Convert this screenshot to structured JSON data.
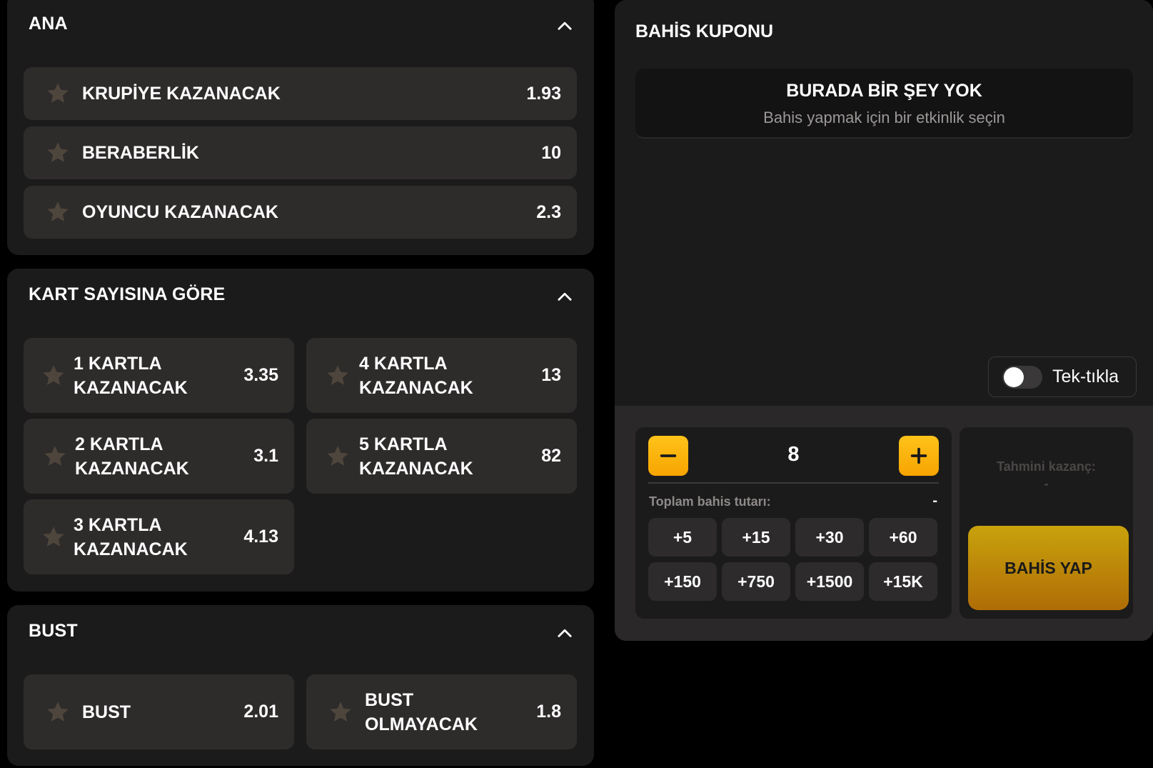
{
  "markets": {
    "main": {
      "title": "ANA",
      "rows": [
        {
          "label": "KRUPİYE KAZANACAK",
          "odd": "1.93"
        },
        {
          "label": "BERABERLİK",
          "odd": "10"
        },
        {
          "label": "OYUNCU KAZANACAK",
          "odd": "2.3"
        }
      ]
    },
    "cards": {
      "title": "KART SAYISINA GÖRE",
      "items": [
        {
          "line1": "1 KARTLA",
          "line2": "KAZANACAK",
          "odd": "3.35"
        },
        {
          "line1": "4 KARTLA",
          "line2": "KAZANACAK",
          "odd": "13"
        },
        {
          "line1": "2 KARTLA",
          "line2": "KAZANACAK",
          "odd": "3.1"
        },
        {
          "line1": "5 KARTLA",
          "line2": "KAZANACAK",
          "odd": "82"
        },
        {
          "line1": "3 KARTLA",
          "line2": "KAZANACAK",
          "odd": "4.13"
        }
      ]
    },
    "bust": {
      "title": "BUST",
      "items": [
        {
          "label": "BUST",
          "odd": "2.01"
        },
        {
          "line1": "BUST",
          "line2": "OLMAYACAK",
          "odd": "1.8"
        }
      ]
    }
  },
  "slip": {
    "title": "BAHİS KUPONU",
    "empty_title": "BURADA BİR ŞEY YOK",
    "empty_subtitle": "Bahis yapmak için bir etkinlik seçin",
    "one_click_label": "Tek-tıkla",
    "one_click_on": false,
    "stake": "8",
    "total_label": "Toplam bahis tutarı:",
    "total_value": "-",
    "chips": [
      "+5",
      "+15",
      "+30",
      "+60",
      "+150",
      "+750",
      "+1500",
      "+15K"
    ],
    "estimated_label": "Tahmini kazanç:",
    "estimated_value": "-",
    "place_bet": "BAHİS YAP"
  },
  "colors": {
    "accent": "#f7a400",
    "panel": "#1c1b1b",
    "row": "#2e2b2b",
    "star": "#4e463c"
  }
}
